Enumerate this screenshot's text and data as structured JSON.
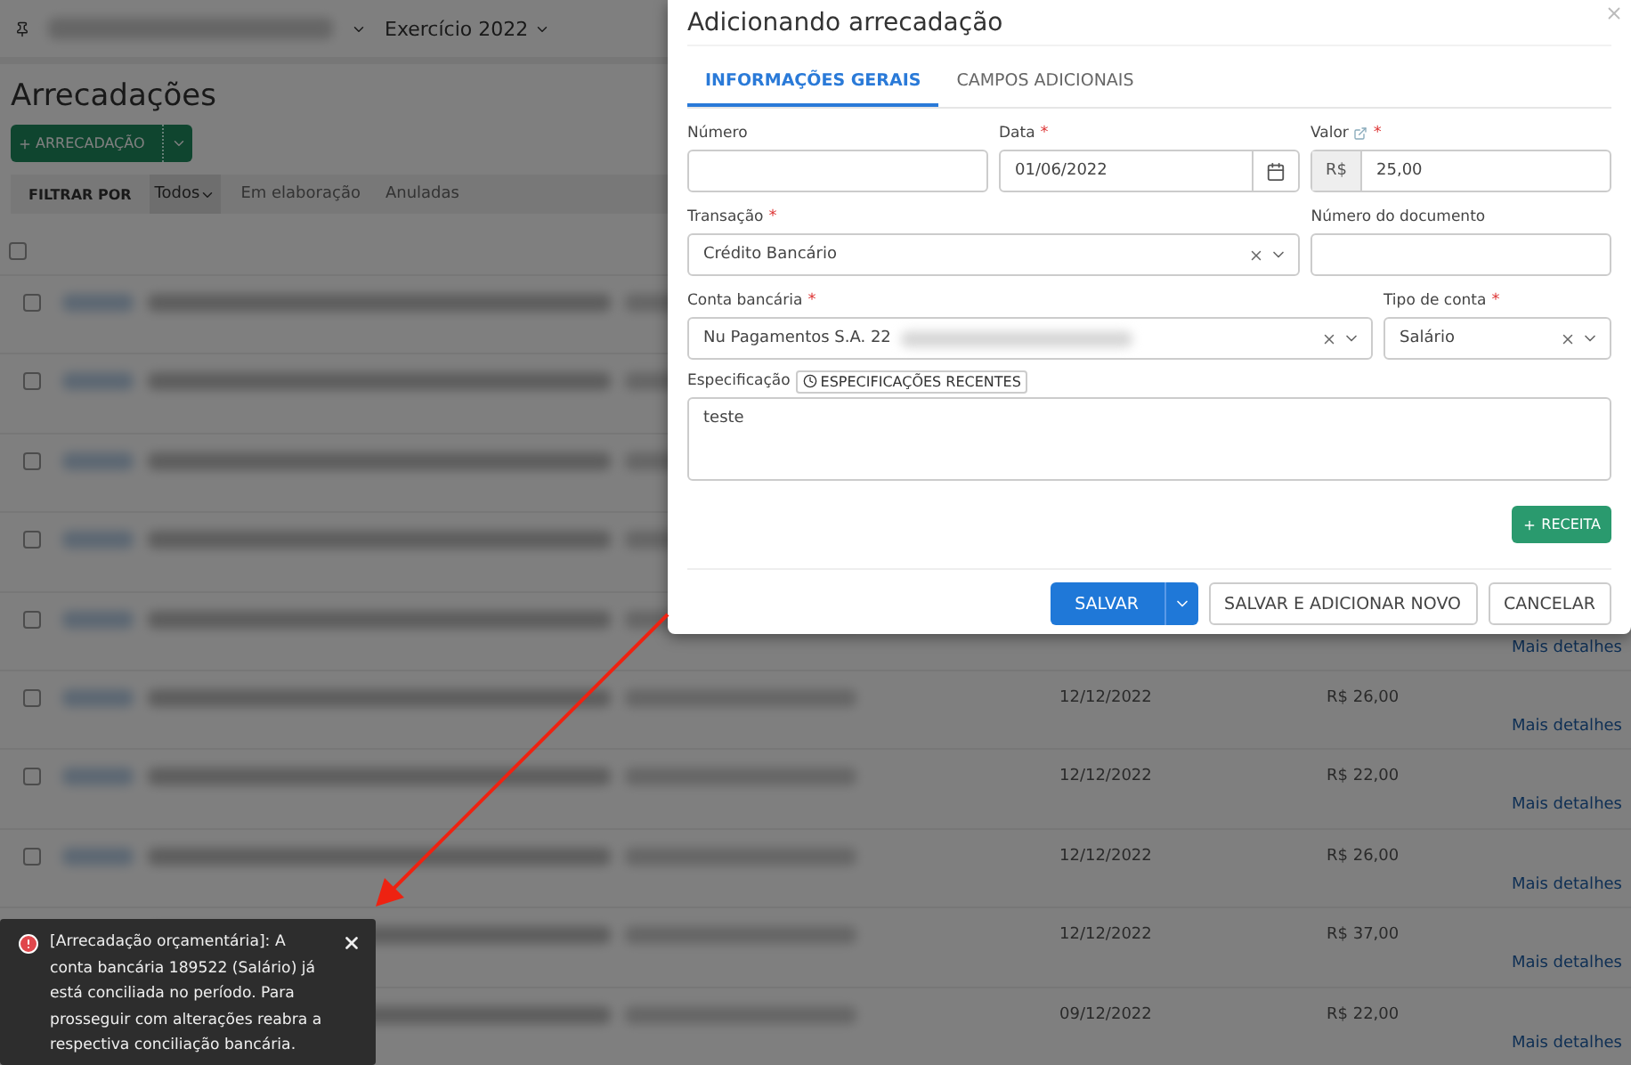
{
  "topbar": {
    "exercise": "Exercício 2022"
  },
  "page": {
    "title": "Arrecadações",
    "add_button": "ARRECADAÇÃO",
    "filter_label": "FILTRAR POR",
    "filters": [
      {
        "label": "Todos",
        "selected": true
      },
      {
        "label": "Em elaboração",
        "selected": false
      },
      {
        "label": "Anuladas",
        "selected": false
      }
    ],
    "select_all_checked": false,
    "rows": [
      {
        "checked": false
      },
      {
        "checked": false
      },
      {
        "checked": false
      },
      {
        "checked": false
      },
      {
        "checked": false,
        "link": "Mais detalhes"
      },
      {
        "checked": false,
        "date": "12/12/2022",
        "amount": "R$ 26,00",
        "link": "Mais detalhes"
      },
      {
        "checked": false,
        "date": "12/12/2022",
        "amount": "R$ 22,00",
        "link": "Mais detalhes"
      },
      {
        "checked": false,
        "date": "12/12/2022",
        "amount": "R$ 26,00",
        "link": "Mais detalhes"
      },
      {
        "date": "12/12/2022",
        "amount": "R$ 37,00",
        "link": "Mais detalhes"
      },
      {
        "date": "09/12/2022",
        "amount": "R$ 22,00",
        "link": "Mais detalhes"
      }
    ]
  },
  "modal": {
    "title": "Adicionando arrecadação",
    "tabs": [
      {
        "label": "INFORMAÇÕES GERAIS",
        "selected": true
      },
      {
        "label": "CAMPOS ADICIONAIS",
        "selected": false
      }
    ],
    "form_rows": [
      [
        {
          "kind": "text",
          "label": "Número"
        },
        {
          "kind": "date",
          "label": "Data",
          "required_mark": "*",
          "value": "01/06/2022"
        },
        {
          "kind": "currency",
          "label": "Valor",
          "required_mark": "*",
          "info": true,
          "prefix": "R$",
          "value": "25,00"
        }
      ],
      [
        {
          "kind": "select",
          "label": "Transação",
          "required_mark": "*",
          "value": "Crédito Bancário"
        },
        {
          "kind": "text",
          "label": "Número do documento"
        }
      ],
      [
        {
          "kind": "select",
          "label": "Conta bancária",
          "required_mark": "*",
          "value": "Nu Pagamentos S.A. 22",
          "redacted": true
        },
        {
          "kind": "select",
          "label": "Tipo de conta",
          "required_mark": "*",
          "value": "Salário"
        }
      ]
    ],
    "specification": {
      "label": "Especificação",
      "recent_button": "ESPECIFICAÇÕES RECENTES",
      "value": "teste"
    },
    "add_revenue_button": "RECEITA",
    "footer": {
      "save": "SALVAR",
      "save_new": "SALVAR E ADICIONAR NOVO",
      "cancel": "CANCELAR"
    }
  },
  "toast": {
    "message": "[Arrecadação orçamentária]: A conta bancária 189522 (Salário) já está conciliada no período. Para prosseguir com alterações reabra a respectiva conciliação bancária."
  }
}
